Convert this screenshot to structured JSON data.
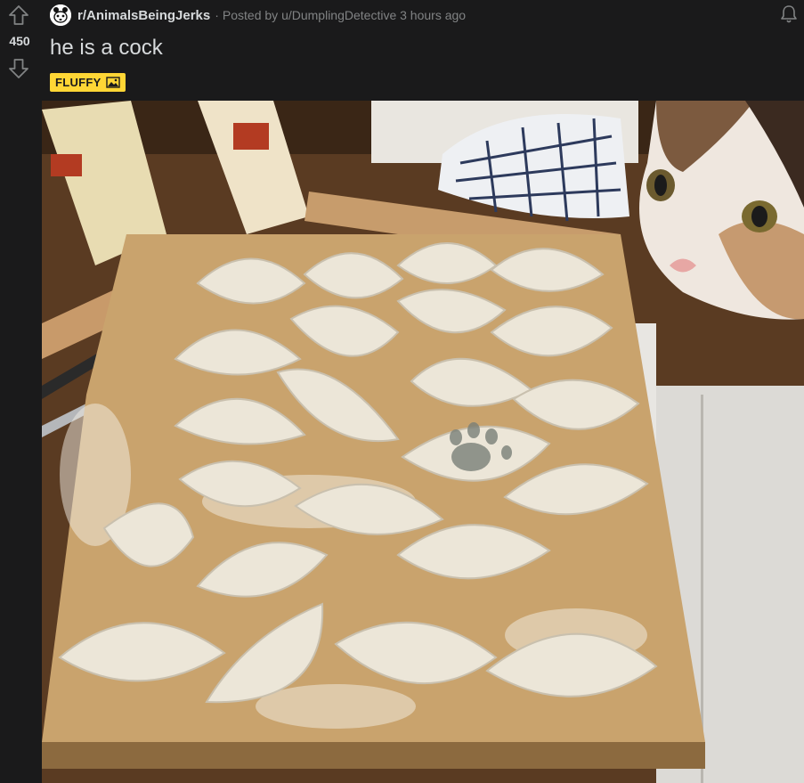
{
  "post": {
    "score": "450",
    "subreddit": "r/AnimalsBeingJerks",
    "meta_prefix": "Posted by",
    "author": "u/DumplingDetective",
    "time": "3 hours ago",
    "title": "he is a cock",
    "flair": "FLUFFY"
  },
  "icons": {
    "upvote": "upvote-arrow-icon",
    "downvote": "downvote-arrow-icon",
    "notifications": "bell-icon",
    "subreddit": "subreddit-avatar-icon",
    "flair_media": "image-icon"
  },
  "image": {
    "description": "Photo of rows of homemade dumplings on a floured wooden cutting board; a calico cat on the right leans in, and one dumpling has a paw print pressed into it.",
    "colors": {
      "board": "#c9a36d",
      "dumpling": "#ece6d8",
      "table": "#5a3b22",
      "cat_fur": "#efe7df"
    }
  },
  "colors": {
    "background": "#1a1a1b",
    "text": "#d7dadc",
    "meta": "#818384",
    "flair_bg": "#ffd635"
  }
}
